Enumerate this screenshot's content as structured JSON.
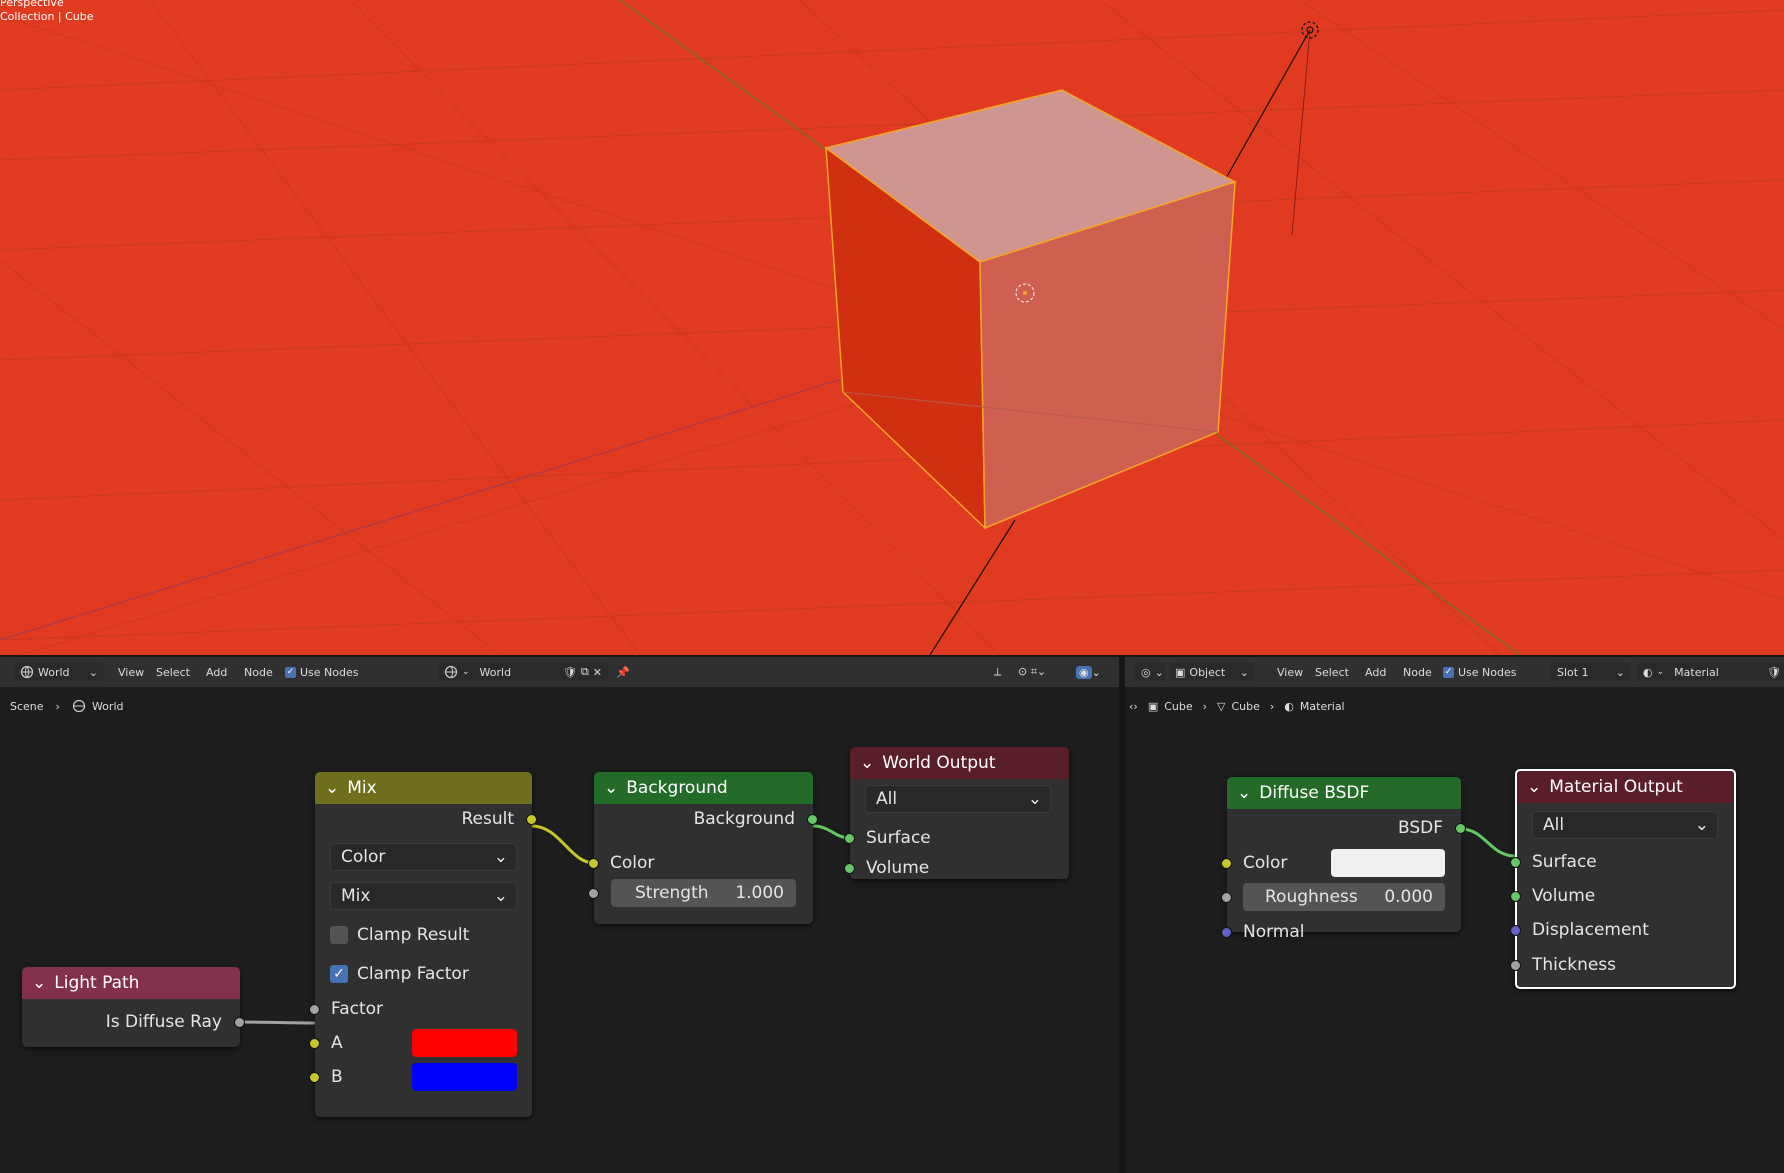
{
  "viewport": {
    "label_mode": "Perspective",
    "label_collection": "Collection | Cube",
    "background_color": "#e03a20"
  },
  "left_editor": {
    "header": {
      "editor_type_label": "World",
      "menu": [
        "View",
        "Select",
        "Add",
        "Node"
      ],
      "use_nodes_label": "Use Nodes",
      "use_nodes_checked": true,
      "datablock_name": "World"
    },
    "breadcrumb": [
      "Scene",
      "World"
    ],
    "nodes": {
      "mix": {
        "title": "Mix",
        "result_label": "Result",
        "data_type": "Color",
        "blend_mode": "Mix",
        "clamp_result_label": "Clamp Result",
        "clamp_result_checked": false,
        "clamp_factor_label": "Clamp Factor",
        "clamp_factor_checked": true,
        "factor_label": "Factor",
        "a_label": "A",
        "b_label": "B",
        "a_color": "#ff0000",
        "b_color": "#0000ff",
        "header_color": "#6e6e1d"
      },
      "light_path": {
        "title": "Light Path",
        "output_label": "Is Diffuse Ray",
        "header_color": "#83314a"
      },
      "background": {
        "title": "Background",
        "output_label": "Background",
        "color_label": "Color",
        "strength_label": "Strength",
        "strength_value": "1.000",
        "header_color": "#246b2a"
      },
      "world_output": {
        "title": "World Output",
        "target": "All",
        "surface_label": "Surface",
        "volume_label": "Volume",
        "header_color": "#5a1e2a"
      }
    }
  },
  "right_editor": {
    "header": {
      "object_mode_label": "Object",
      "menu": [
        "View",
        "Select",
        "Add",
        "Node"
      ],
      "use_nodes_label": "Use Nodes",
      "use_nodes_checked": true,
      "slot_label": "Slot 1",
      "datablock_name": "Material"
    },
    "breadcrumb": [
      "Cube",
      "Cube",
      "Material"
    ],
    "nodes": {
      "diffuse": {
        "title": "Diffuse BSDF",
        "output_label": "BSDF",
        "color_label": "Color",
        "roughness_label": "Roughness",
        "roughness_value": "0.000",
        "normal_label": "Normal",
        "color_swatch": "#f0f0f0",
        "header_color": "#246b2a"
      },
      "material_output": {
        "title": "Material Output",
        "target": "All",
        "surface_label": "Surface",
        "volume_label": "Volume",
        "displacement_label": "Displacement",
        "thickness_label": "Thickness",
        "header_color": "#5a1e2a"
      }
    }
  }
}
